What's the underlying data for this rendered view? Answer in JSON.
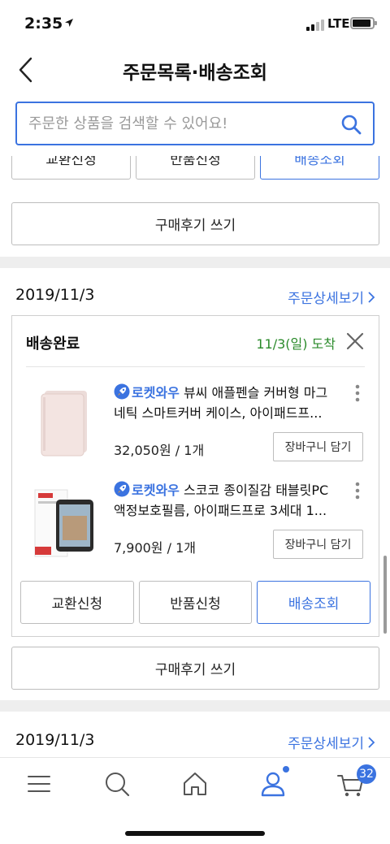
{
  "status_bar": {
    "time": "2:35",
    "network": "LTE"
  },
  "header": {
    "title": "주문목록·배송조회"
  },
  "search": {
    "placeholder": "주문한 상품을 검색할 수 있어요!"
  },
  "order_top": {
    "buttons": [
      "교환신청",
      "반품신청",
      "배송조회"
    ],
    "review_label": "구매후기 쓰기"
  },
  "order_main": {
    "date": "2019/11/3",
    "detail_link": "주문상세보기",
    "status": "배송완료",
    "arrival": "11/3(일) 도착",
    "items": [
      {
        "badge": "로켓와우",
        "title_line1": "뷰씨 애플펜슬 커버형 마그",
        "title_line2": "네틱 스마트커버 케이스, 아이패드프...",
        "price": "32,050원 / 1개",
        "cart_label": "장바구니 담기"
      },
      {
        "badge": "로켓와우",
        "title_line1": "스코코 종이질감 태블릿PC",
        "title_line2": "액정보호필름, 아이패드프로 3세대 1...",
        "price": "7,900원 / 1개",
        "cart_label": "장바구니 담기"
      }
    ],
    "buttons": [
      "교환신청",
      "반품신청",
      "배송조회"
    ],
    "review_label": "구매후기 쓰기"
  },
  "order_next": {
    "date": "2019/11/3",
    "detail_link": "주문상세보기"
  },
  "bottom_nav": {
    "items": [
      "menu-icon",
      "search-icon",
      "home-icon",
      "user-icon",
      "cart-icon"
    ],
    "cart_count": "32"
  },
  "colors": {
    "accent": "#3b73e0",
    "arrival": "#2a8a2a",
    "separator": "#eeeeee"
  }
}
